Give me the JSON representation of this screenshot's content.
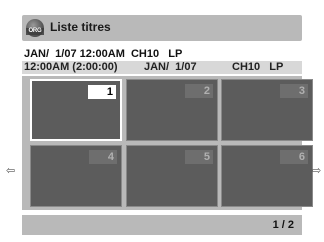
{
  "header": {
    "icon_label": "ORG",
    "title": "Liste titres"
  },
  "selected_title": {
    "info": "JAN/  1/07 12:00AM  CH10   LP",
    "time": "12:00AM (2:00:00)",
    "date": "JAN/  1/07",
    "channel_mode": "CH10   LP"
  },
  "thumbnails": [
    {
      "number": "1"
    },
    {
      "number": "2"
    },
    {
      "number": "3"
    },
    {
      "number": "4"
    },
    {
      "number": "5"
    },
    {
      "number": "6"
    }
  ],
  "navigation": {
    "left_arrow": "⇦",
    "right_arrow": "⇨"
  },
  "footer": {
    "page": "1 / 2"
  },
  "colors": {
    "bar": "#b9b9b9",
    "thumbnail": "#5c5c5c",
    "selected_border": "#ffffff"
  }
}
